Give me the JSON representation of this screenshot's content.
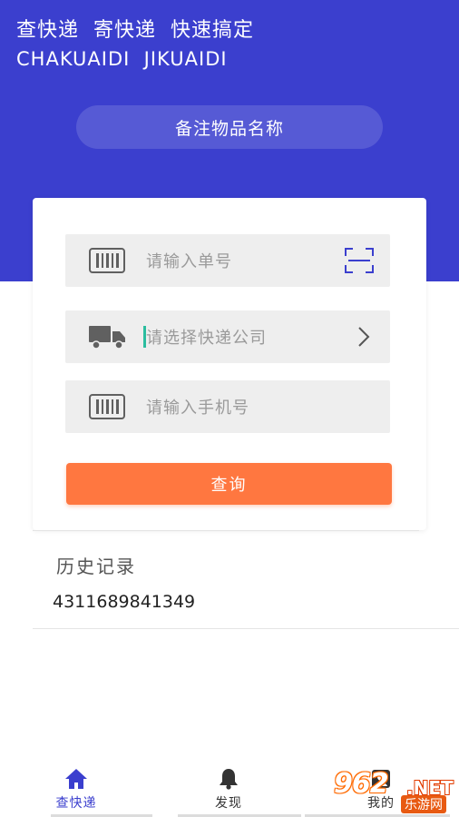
{
  "header": {
    "slogan": "查快递  寄快递  快速搞定",
    "slogan_en": "CHAKUAIDI  JIKUAIDI",
    "remark_label": "备注物品名称"
  },
  "form": {
    "tracking_placeholder": "请输入单号",
    "courier_placeholder": "请选择快递公司",
    "phone_placeholder": "请输入手机号",
    "query_button": "查询"
  },
  "history": {
    "title": "历史记录",
    "items": [
      "4311689841349"
    ]
  },
  "tabs": [
    {
      "label": "查快递",
      "icon": "home-icon",
      "active": true
    },
    {
      "label": "发现",
      "icon": "bell-icon",
      "active": false
    },
    {
      "label": "我的",
      "icon": "profile-icon",
      "active": false
    }
  ],
  "watermark": {
    "brand": "962",
    "domain": ".NET",
    "site_name": "乐游网"
  },
  "colors": {
    "primary": "#3b3fce",
    "accent": "#ff7740",
    "field_bg": "#eeeeee"
  }
}
